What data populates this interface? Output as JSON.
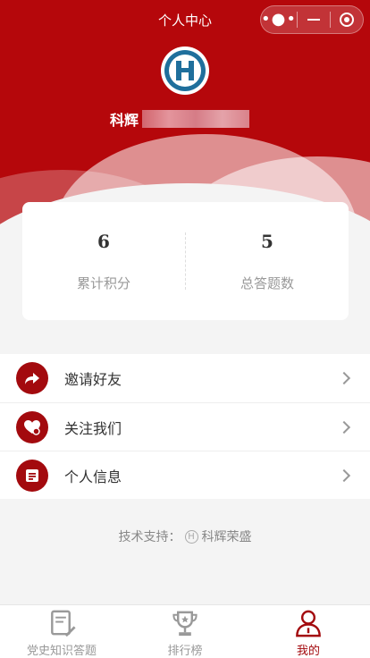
{
  "nav": {
    "title": "个人中心",
    "capsule": [
      "more-dots",
      "minimize",
      "close-target"
    ]
  },
  "profile": {
    "name_visible": "科辉"
  },
  "stats": [
    {
      "value": "6",
      "label": "累计积分"
    },
    {
      "value": "5",
      "label": "总答题数"
    }
  ],
  "menu": [
    {
      "label": "邀请好友",
      "icon": "share-arrow-icon"
    },
    {
      "label": "关注我们",
      "icon": "heart-icon"
    },
    {
      "label": "个人信息",
      "icon": "document-icon"
    }
  ],
  "footer": {
    "prefix": "技术支持：",
    "company": "科辉荣盛"
  },
  "tabbar": [
    {
      "label": "党史知识答题",
      "icon": "quiz-icon",
      "active": false
    },
    {
      "label": "排行榜",
      "icon": "trophy-icon",
      "active": false
    },
    {
      "label": "我的",
      "icon": "user-icon",
      "active": true
    }
  ],
  "colors": {
    "brand_red": "#b5070b",
    "icon_red": "#a30a0e",
    "background": "#f4f4f4"
  }
}
